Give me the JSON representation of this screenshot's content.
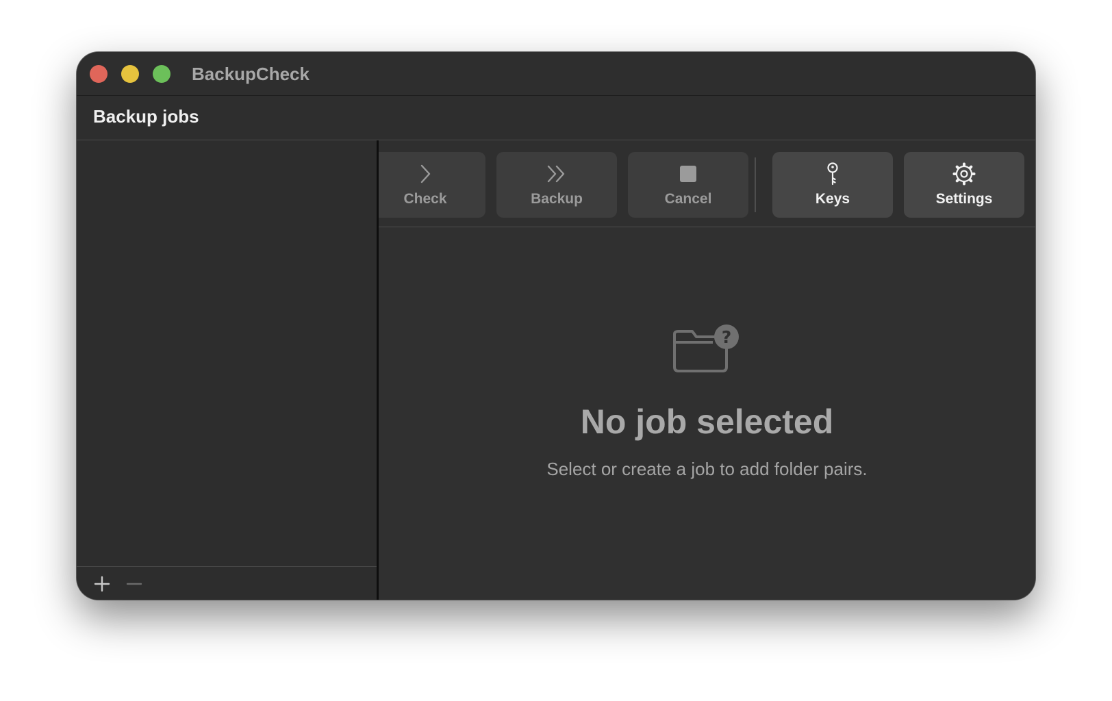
{
  "window": {
    "title": "BackupCheck"
  },
  "sidebar": {
    "header": "Backup jobs",
    "items": [],
    "footer": {
      "add_icon": "plus-icon",
      "remove_icon": "minus-icon"
    }
  },
  "toolbar": {
    "buttons": [
      {
        "label": "Check",
        "icon": "chevron-right-icon",
        "enabled": false
      },
      {
        "label": "Backup",
        "icon": "double-chevron-right-icon",
        "enabled": false
      },
      {
        "label": "Cancel",
        "icon": "stop-square-icon",
        "enabled": false
      },
      {
        "label": "Keys",
        "icon": "key-icon",
        "enabled": true
      },
      {
        "label": "Settings",
        "icon": "gear-icon",
        "enabled": true
      }
    ]
  },
  "empty_state": {
    "icon": "folder-question-icon",
    "title": "No job selected",
    "subtitle": "Select or create a job to add folder pairs."
  },
  "colors": {
    "close": "#e0665a",
    "minimize": "#e6c33e",
    "zoom": "#6cc05a",
    "window_bg": "#2f2f2f",
    "button_bg": "#3d3d3d"
  }
}
